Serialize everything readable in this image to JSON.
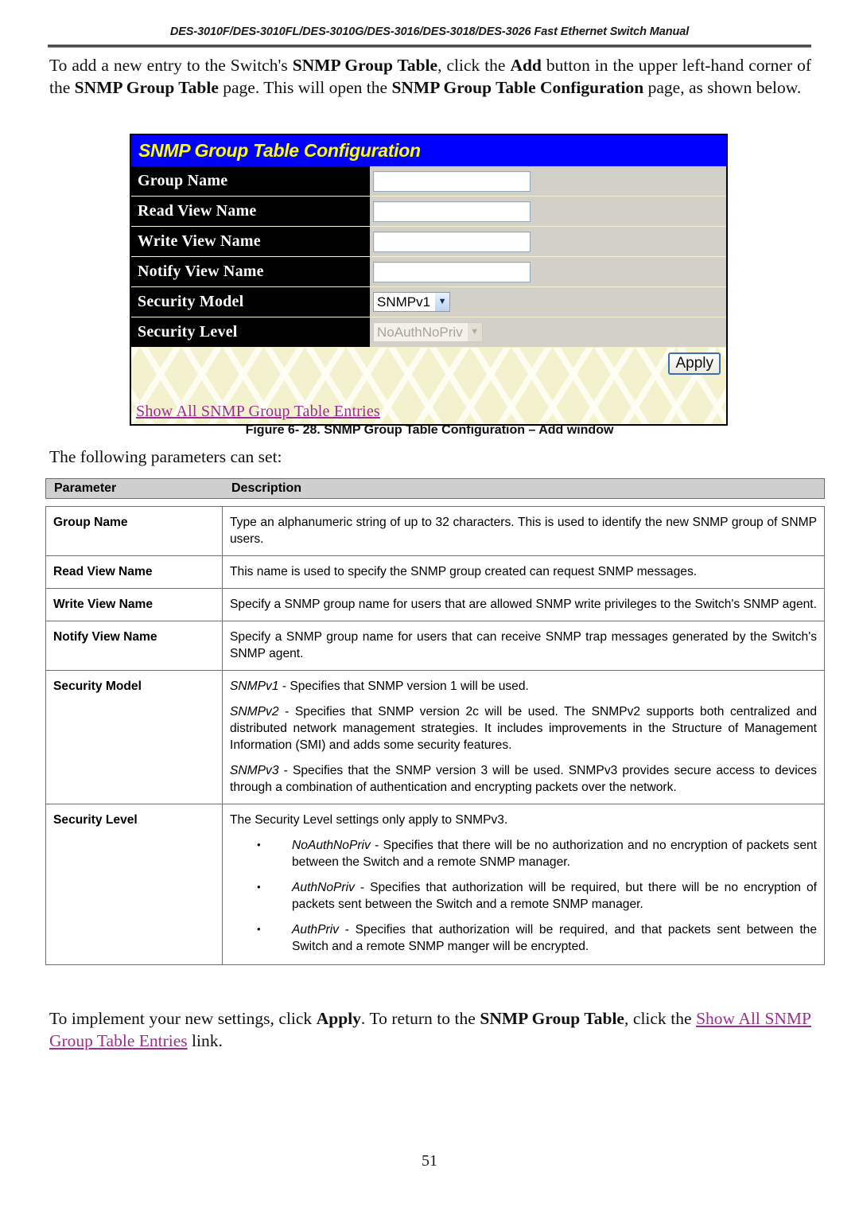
{
  "header": {
    "running_head": "DES-3010F/DES-3010FL/DES-3010G/DES-3016/DES-3018/DES-3026 Fast Ethernet Switch Manual"
  },
  "intro_paragraph": {
    "part1": "To add a new entry to the Switch's ",
    "bold1": "SNMP Group Table",
    "part2": ", click the ",
    "bold2": "Add",
    "part3": " button in the upper left-hand corner of the ",
    "bold3": "SNMP Group Table",
    "part4": " page. This will open the ",
    "bold4": "SNMP Group Table Configuration",
    "part5": " page, as shown below."
  },
  "snmp_panel": {
    "title": "SNMP Group Table Configuration",
    "rows": [
      {
        "label": "Group Name",
        "control": "textbox",
        "value": ""
      },
      {
        "label": "Read View Name",
        "control": "textbox",
        "value": ""
      },
      {
        "label": "Write View Name",
        "control": "textbox",
        "value": ""
      },
      {
        "label": "Notify View Name",
        "control": "textbox",
        "value": ""
      },
      {
        "label": "Security Model",
        "control": "select",
        "value": "SNMPv1",
        "disabled": false
      },
      {
        "label": "Security Level",
        "control": "select",
        "value": "NoAuthNoPriv",
        "disabled": true
      }
    ],
    "apply_label": "Apply",
    "show_all_link": "Show All SNMP Group Table Entries",
    "colors": {
      "title_bg": "#0000FF",
      "title_fg": "#FFFF00",
      "label_bg": "#000000",
      "label_fg": "#FFFFFF",
      "value_bg": "#D3D0C9",
      "panel_bg": "#F4F1CF",
      "link_fg": "#9B2E8F",
      "button_border": "#3C6FB4"
    }
  },
  "figure_caption": "Figure 6- 28. SNMP Group Table Configuration – Add window",
  "follow_text": "The following parameters can set:",
  "param_table": {
    "headers": {
      "parameter": "Parameter",
      "description": "Description"
    },
    "rows": [
      {
        "name": "Group Name",
        "desc_paragraphs": [
          "Type an alphanumeric string of up to 32 characters. This is used to identify the new SNMP group of SNMP users."
        ]
      },
      {
        "name": "Read View Name",
        "desc_paragraphs": [
          "This name is used to specify the SNMP group created can request SNMP messages."
        ]
      },
      {
        "name": "Write View Name",
        "desc_paragraphs": [
          "Specify a SNMP group name for users that are allowed SNMP write privileges to the Switch's SNMP agent."
        ]
      },
      {
        "name": "Notify View Name",
        "desc_paragraphs": [
          "Specify a SNMP group name for users that can receive SNMP trap messages generated by the Switch's SNMP agent."
        ]
      },
      {
        "name": "Security Model",
        "items": [
          {
            "term": "SNMPv1",
            "text": " - Specifies that SNMP version 1 will be used."
          },
          {
            "term": "SNMPv2",
            "text": " - Specifies that SNMP version 2c will be used. The SNMPv2 supports both centralized and distributed network management strategies. It includes improvements in the Structure of Management Information (SMI) and adds some security features."
          },
          {
            "term": "SNMPv3",
            "text": " - Specifies that the SNMP version 3 will be used. SNMPv3 provides secure access to devices through a combination of authentication and encrypting packets over the network."
          }
        ]
      },
      {
        "name": "Security Level",
        "lead": "The Security Level settings only apply to SNMPv3.",
        "bullets": [
          {
            "term": "NoAuthNoPriv",
            "text": " - Specifies that there will be no authorization and no encryption of packets sent between the Switch and a remote SNMP manager."
          },
          {
            "term": "AuthNoPriv",
            "text": " - Specifies that authorization will be required, but there will be no encryption of packets sent between the Switch and a remote SNMP manager."
          },
          {
            "term": "AuthPriv",
            "text": " - Specifies that authorization will be required, and that packets sent between the Switch and a remote SNMP manger will be encrypted."
          }
        ]
      }
    ]
  },
  "closing_paragraph": {
    "part1": "To implement your new settings, click ",
    "bold1": "Apply",
    "part2": ". To return to the ",
    "bold2": "SNMP Group Table",
    "part3": ", click the ",
    "link": "Show All SNMP Group Table Entries",
    "part4": " link."
  },
  "page_number": "51"
}
